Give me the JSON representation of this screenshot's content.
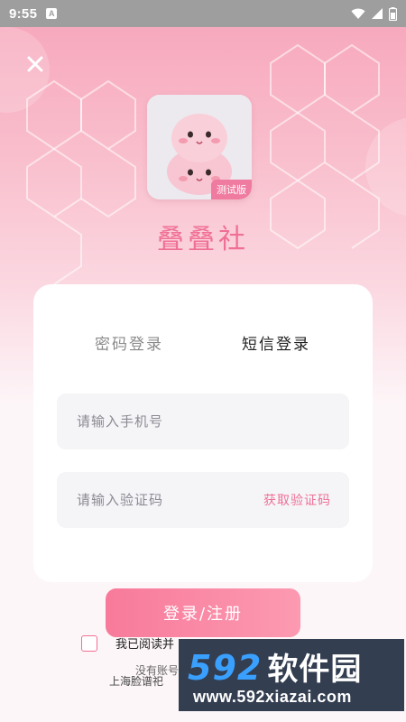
{
  "status_bar": {
    "time": "9:55",
    "notification_icon": "A"
  },
  "header": {
    "close_icon": "close-icon"
  },
  "logo": {
    "badge": "测试版"
  },
  "app": {
    "title": "叠叠社"
  },
  "tabs": [
    {
      "label": "密码登录",
      "active": false
    },
    {
      "label": "短信登录",
      "active": true
    }
  ],
  "form": {
    "phone_placeholder": "请输入手机号",
    "code_placeholder": "请输入验证码",
    "get_code_label": "获取验证码",
    "submit_label": "登录/注册"
  },
  "agreement": {
    "text": "我已阅读并"
  },
  "footer": {
    "no_account": "没有账号",
    "company": "上海脸谱祀"
  },
  "watermark": {
    "logo_num": "592",
    "logo_cn": "软件园",
    "url": "www.592xiazai.com"
  },
  "colors": {
    "accent": "#f06f95",
    "button_start": "#f87a9b",
    "button_end": "#fc9ab1"
  }
}
